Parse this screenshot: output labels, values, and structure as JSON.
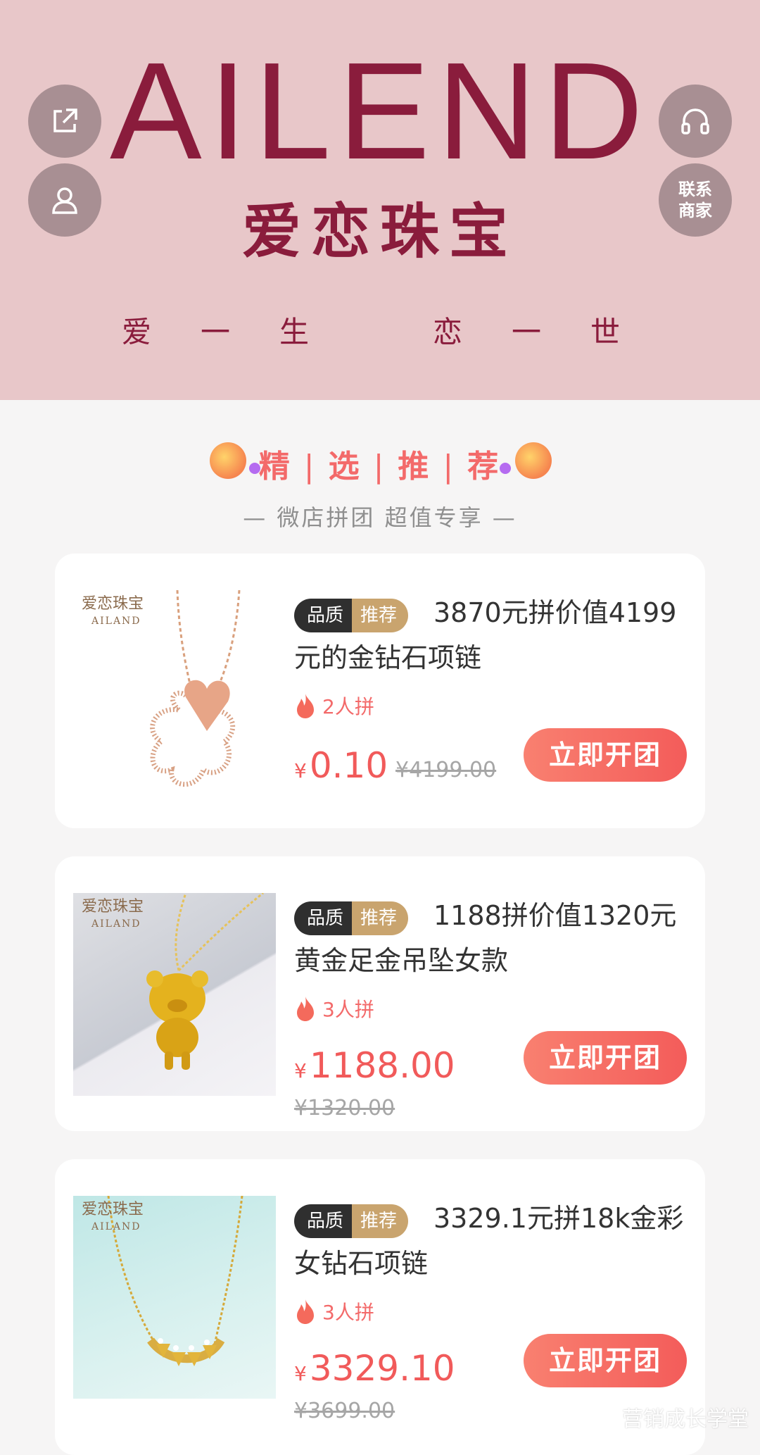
{
  "banner": {
    "brand_en": "AILEND",
    "brand_cn": "爱恋珠宝",
    "slogan_left": [
      "爱",
      "一",
      "生"
    ],
    "slogan_right": [
      "恋",
      "一",
      "世"
    ],
    "contact_label": "联系商家"
  },
  "section": {
    "title_items": [
      "精",
      "选",
      "推",
      "荐"
    ],
    "separator": "|",
    "subtitle": "— 微店拼团 超值专享 —"
  },
  "badge": {
    "quality": "品质",
    "recommend": "推荐"
  },
  "buy_label": "立即开团",
  "currency": "¥",
  "products": [
    {
      "title": "3870元拼价值4199元的金钻石项链",
      "group": "2人拼",
      "price": "0.10",
      "original_price": "¥4199.00",
      "thumb_logo_cn": "爱恋珠宝",
      "thumb_logo_en": "AILAND"
    },
    {
      "title": "1188拼价值1320元黄金足金吊坠女款",
      "group": "3人拼",
      "price": "1188.00",
      "original_price": "¥1320.00",
      "thumb_logo_cn": "爱恋珠宝",
      "thumb_logo_en": "AILAND"
    },
    {
      "title": "3329.1元拼18k金彩女钻石项链",
      "group": "3人拼",
      "price": "3329.10",
      "original_price": "¥3699.00",
      "thumb_logo_cn": "爱恋珠宝",
      "thumb_logo_en": "AILAND"
    }
  ],
  "watermark": "营销成长学堂",
  "colors": {
    "banner_bg": "#e8c7c9",
    "brand": "#8a1c3c",
    "accent_red": "#f15a5a",
    "badge_dark": "#2f2f2f",
    "badge_gold": "#c9a46e"
  }
}
